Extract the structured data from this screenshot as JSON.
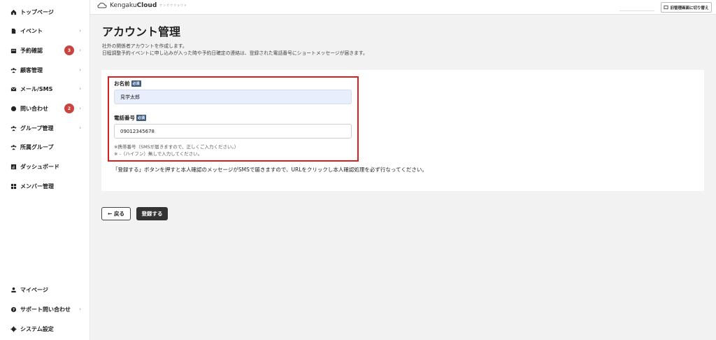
{
  "sidebar": {
    "items": [
      {
        "label": "トップページ",
        "icon": "home-icon"
      },
      {
        "label": "イベント",
        "icon": "document-icon",
        "chevron": "›"
      },
      {
        "label": "予約確認",
        "icon": "calendar-icon",
        "badge": "3",
        "chevron": "›"
      },
      {
        "label": "顧客管理",
        "icon": "people-icon",
        "chevron": "›"
      },
      {
        "label": "メール/SMS",
        "icon": "mail-icon",
        "chevron": "›"
      },
      {
        "label": "問い合わせ",
        "icon": "chat-icon",
        "badge": "2",
        "chevron": "›"
      },
      {
        "label": "グループ管理",
        "icon": "group-icon",
        "chevron": "›"
      },
      {
        "label": "所属グループ",
        "icon": "group-icon"
      },
      {
        "label": "ダッシュボード",
        "icon": "chart-icon"
      },
      {
        "label": "メンバー管理",
        "icon": "grid-icon"
      }
    ],
    "bottom_items": [
      {
        "label": "マイページ",
        "icon": "person-icon"
      },
      {
        "label": "サポート問い合わせ",
        "icon": "help-icon",
        "chevron": "›"
      },
      {
        "label": "システム設定",
        "icon": "gear-icon"
      }
    ]
  },
  "topbar": {
    "logo_light": "Kengaku",
    "logo_bold": "Cloud",
    "logo_sub": "ケンガククラウド",
    "switch_label": "旧管理画面に切り替え"
  },
  "page": {
    "title": "アカウント管理",
    "desc1": "社外の関係者アカウントを作成します。",
    "desc2": "日程調整予約イベントに申し込みが入った時や予約日確定の連絡は、登録された電話番号にショートメッセージが届きます。"
  },
  "form": {
    "name_label": "お名前",
    "required": "必須",
    "name_value": "見学太郎",
    "phone_label": "電話番号",
    "phone_value": "09012345678",
    "note1": "※携帯番号（SMSが届きますので、正しくご入力ください。）",
    "note2": "※ -（ハイフン）無しで入力してください。",
    "instruction": "「登録する」ボタンを押すと本人確認のメッセージがSMSで届きますので、URLをクリックし本人確認処理を必ず行なってください。"
  },
  "buttons": {
    "back": "← 戻る",
    "submit": "登録する"
  },
  "colors": {
    "highlight": "#d81e1e",
    "badge": "#c9443f",
    "required_tag": "#3d5a80",
    "primary_button": "#333333"
  }
}
